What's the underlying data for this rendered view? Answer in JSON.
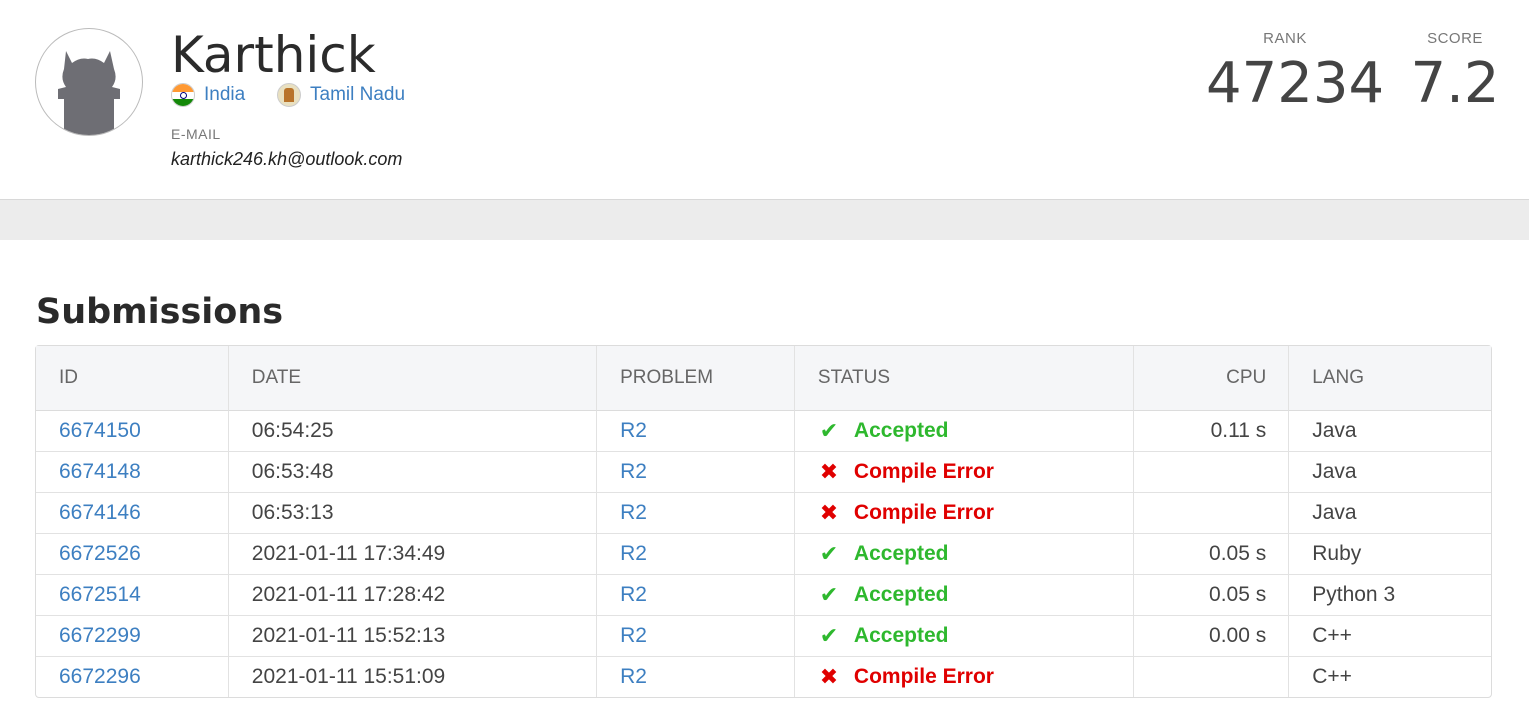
{
  "profile": {
    "name": "Karthick",
    "country": "India",
    "region": "Tamil Nadu",
    "email_label": "E-MAIL",
    "email": "karthick246.kh@outlook.com",
    "rank_label": "RANK",
    "rank": "47234",
    "score_label": "SCORE",
    "score": "7.2"
  },
  "submissions": {
    "title": "Submissions",
    "columns": [
      "ID",
      "DATE",
      "PROBLEM",
      "STATUS",
      "CPU",
      "LANG"
    ],
    "rows": [
      {
        "id": "6674150",
        "date": "06:54:25",
        "problem": "R2",
        "status": "Accepted",
        "ok": true,
        "cpu": "0.11 s",
        "lang": "Java"
      },
      {
        "id": "6674148",
        "date": "06:53:48",
        "problem": "R2",
        "status": "Compile Error",
        "ok": false,
        "cpu": "",
        "lang": "Java"
      },
      {
        "id": "6674146",
        "date": "06:53:13",
        "problem": "R2",
        "status": "Compile Error",
        "ok": false,
        "cpu": "",
        "lang": "Java"
      },
      {
        "id": "6672526",
        "date": "2021-01-11 17:34:49",
        "problem": "R2",
        "status": "Accepted",
        "ok": true,
        "cpu": "0.05 s",
        "lang": "Ruby"
      },
      {
        "id": "6672514",
        "date": "2021-01-11 17:28:42",
        "problem": "R2",
        "status": "Accepted",
        "ok": true,
        "cpu": "0.05 s",
        "lang": "Python 3"
      },
      {
        "id": "6672299",
        "date": "2021-01-11 15:52:13",
        "problem": "R2",
        "status": "Accepted",
        "ok": true,
        "cpu": "0.00 s",
        "lang": "C++"
      },
      {
        "id": "6672296",
        "date": "2021-01-11 15:51:09",
        "problem": "R2",
        "status": "Compile Error",
        "ok": false,
        "cpu": "",
        "lang": "C++"
      }
    ]
  },
  "colors": {
    "link": "#3d7fc1",
    "accepted": "#2eb82e",
    "error": "#e00000"
  },
  "icons": {
    "accepted": "check-icon",
    "error": "cross-icon"
  }
}
